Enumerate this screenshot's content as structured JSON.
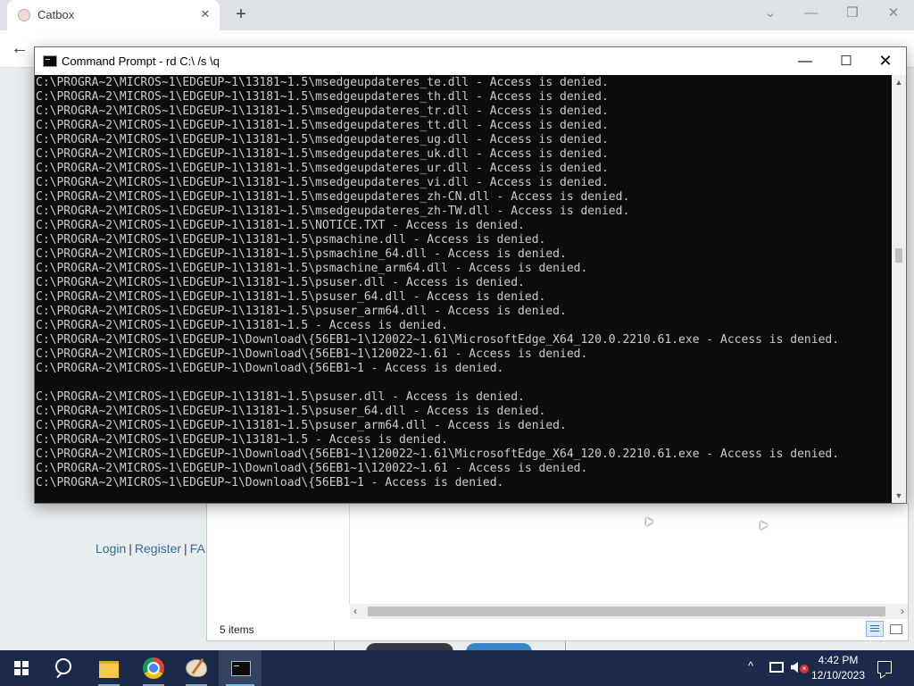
{
  "browser": {
    "tab_title": "Catbox",
    "tab_close": "✕",
    "new_tab": "+",
    "back": "←",
    "window_controls": {
      "minimize": "—",
      "restore": "❐",
      "close": "✕",
      "tab_search": "⌄"
    }
  },
  "page": {
    "links": {
      "login": "Login",
      "register": "Register",
      "faq": "FA",
      "separator": "|"
    }
  },
  "explorer": {
    "status": "5 items",
    "scroll_left": "‹",
    "scroll_right": "›"
  },
  "cmd": {
    "title": "Command Prompt - rd  C:\\ /s \\q",
    "controls": {
      "minimize": "—",
      "maximize": "☐",
      "close": "✕"
    },
    "scroll_up": "▲",
    "scroll_down": "▼",
    "lines": [
      "C:\\PROGRA~2\\MICROS~1\\EDGEUP~1\\13181~1.5\\msedgeupdateres_te.dll - Access is denied.",
      "C:\\PROGRA~2\\MICROS~1\\EDGEUP~1\\13181~1.5\\msedgeupdateres_th.dll - Access is denied.",
      "C:\\PROGRA~2\\MICROS~1\\EDGEUP~1\\13181~1.5\\msedgeupdateres_tr.dll - Access is denied.",
      "C:\\PROGRA~2\\MICROS~1\\EDGEUP~1\\13181~1.5\\msedgeupdateres_tt.dll - Access is denied.",
      "C:\\PROGRA~2\\MICROS~1\\EDGEUP~1\\13181~1.5\\msedgeupdateres_ug.dll - Access is denied.",
      "C:\\PROGRA~2\\MICROS~1\\EDGEUP~1\\13181~1.5\\msedgeupdateres_uk.dll - Access is denied.",
      "C:\\PROGRA~2\\MICROS~1\\EDGEUP~1\\13181~1.5\\msedgeupdateres_ur.dll - Access is denied.",
      "C:\\PROGRA~2\\MICROS~1\\EDGEUP~1\\13181~1.5\\msedgeupdateres_vi.dll - Access is denied.",
      "C:\\PROGRA~2\\MICROS~1\\EDGEUP~1\\13181~1.5\\msedgeupdateres_zh-CN.dll - Access is denied.",
      "C:\\PROGRA~2\\MICROS~1\\EDGEUP~1\\13181~1.5\\msedgeupdateres_zh-TW.dll - Access is denied.",
      "C:\\PROGRA~2\\MICROS~1\\EDGEUP~1\\13181~1.5\\NOTICE.TXT - Access is denied.",
      "C:\\PROGRA~2\\MICROS~1\\EDGEUP~1\\13181~1.5\\psmachine.dll - Access is denied.",
      "C:\\PROGRA~2\\MICROS~1\\EDGEUP~1\\13181~1.5\\psmachine_64.dll - Access is denied.",
      "C:\\PROGRA~2\\MICROS~1\\EDGEUP~1\\13181~1.5\\psmachine_arm64.dll - Access is denied.",
      "C:\\PROGRA~2\\MICROS~1\\EDGEUP~1\\13181~1.5\\psuser.dll - Access is denied.",
      "C:\\PROGRA~2\\MICROS~1\\EDGEUP~1\\13181~1.5\\psuser_64.dll - Access is denied.",
      "C:\\PROGRA~2\\MICROS~1\\EDGEUP~1\\13181~1.5\\psuser_arm64.dll - Access is denied.",
      "C:\\PROGRA~2\\MICROS~1\\EDGEUP~1\\13181~1.5 - Access is denied.",
      "C:\\PROGRA~2\\MICROS~1\\EDGEUP~1\\Download\\{56EB1~1\\120022~1.61\\MicrosoftEdge_X64_120.0.2210.61.exe - Access is denied.",
      "C:\\PROGRA~2\\MICROS~1\\EDGEUP~1\\Download\\{56EB1~1\\120022~1.61 - Access is denied.",
      "C:\\PROGRA~2\\MICROS~1\\EDGEUP~1\\Download\\{56EB1~1 - Access is denied.",
      "",
      "C:\\PROGRA~2\\MICROS~1\\EDGEUP~1\\13181~1.5\\psuser.dll - Access is denied.",
      "C:\\PROGRA~2\\MICROS~1\\EDGEUP~1\\13181~1.5\\psuser_64.dll - Access is denied.",
      "C:\\PROGRA~2\\MICROS~1\\EDGEUP~1\\13181~1.5\\psuser_arm64.dll - Access is denied.",
      "C:\\PROGRA~2\\MICROS~1\\EDGEUP~1\\13181~1.5 - Access is denied.",
      "C:\\PROGRA~2\\MICROS~1\\EDGEUP~1\\Download\\{56EB1~1\\120022~1.61\\MicrosoftEdge_X64_120.0.2210.61.exe - Access is denied.",
      "C:\\PROGRA~2\\MICROS~1\\EDGEUP~1\\Download\\{56EB1~1\\120022~1.61 - Access is denied.",
      "C:\\PROGRA~2\\MICROS~1\\EDGEUP~1\\Download\\{56EB1~1 - Access is denied."
    ]
  },
  "taskbar": {
    "apps": [
      "start-icon",
      "search-icon",
      "file-explorer-icon",
      "chrome-icon",
      "paint-icon",
      "command-prompt-icon"
    ],
    "tray_chevron": "^",
    "volume_muted": "×",
    "time": "4:42 PM",
    "date": "12/10/2023"
  },
  "colors": {
    "console_bg": "#0c0c0c",
    "console_text": "#cccccc",
    "taskbar_bg": "#1b2a4a",
    "link_blue": "#3a6a8e"
  }
}
